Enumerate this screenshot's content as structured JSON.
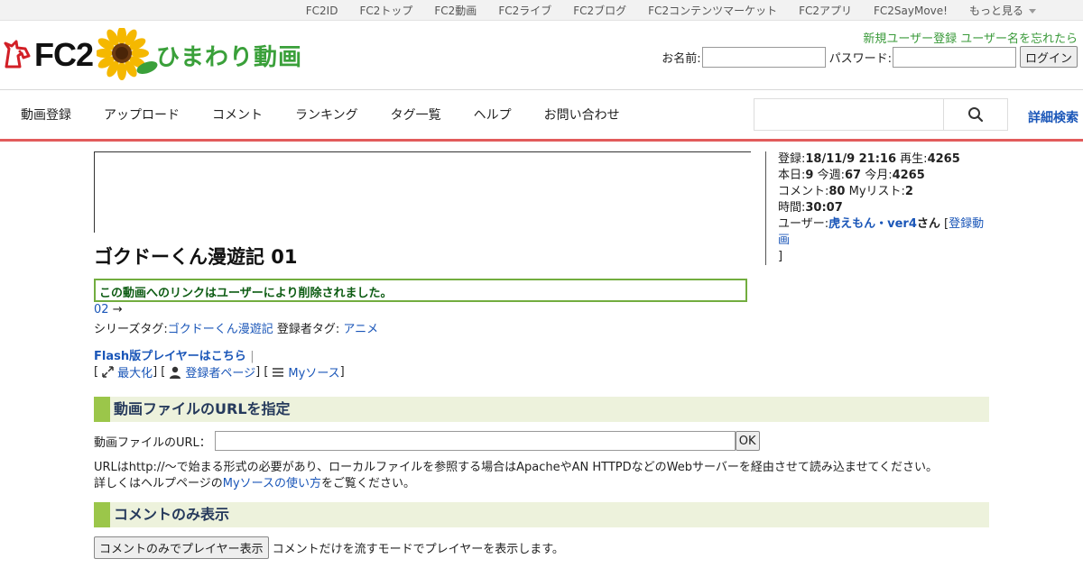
{
  "topnav": {
    "items": [
      "FC2ID",
      "FC2トップ",
      "FC2動画",
      "FC2ライブ",
      "FC2ブログ",
      "FC2コンテンツマーケット",
      "FC2アプリ",
      "FC2SayMove!",
      "もっと見る"
    ]
  },
  "header": {
    "logo_fc2": "FC2",
    "logo_text": "ひまわり動画",
    "register_link": "新規ユーザー登録",
    "forgot_link": "ユーザー名を忘れたら",
    "name_label": "お名前:",
    "password_label": "パスワード:",
    "login_button": "ログイン"
  },
  "nav": {
    "items": [
      "動画登録",
      "アップロード",
      "コメント",
      "ランキング",
      "タグ一覧",
      "ヘルプ",
      "お問い合わせ"
    ],
    "advanced_search": "詳細検索"
  },
  "stats": {
    "registered_label": "登録:",
    "registered_value": "18/11/9 21:16",
    "plays_label": "再生:",
    "plays_value": "4265",
    "today_label": "本日:",
    "today_value": "9",
    "week_label": "今週:",
    "week_value": "67",
    "month_label": "今月:",
    "month_value": "4265",
    "comments_label": "コメント:",
    "comments_value": "80",
    "mylist_label": "Myリスト:",
    "mylist_value": "2",
    "duration_label": "時間:",
    "duration_value": "30:07",
    "user_label": "ユーザー:",
    "user_name": "虎えもん・ver4",
    "user_suffix": "さん",
    "user_videos_link": "登録動画"
  },
  "video": {
    "title": "ゴクドーくん漫遊記 01",
    "notice": "この動画へのリンクはユーザーにより削除されました。",
    "next_link": "02",
    "next_arrow": "→",
    "series_label": "シリーズタグ:",
    "series_tag": "ゴクドーくん漫遊記",
    "uploader_tag_label": "登録者タグ:",
    "uploader_tag": "アニメ",
    "flash_link": "Flash版プレイヤーはこちら",
    "maximize_link": "最大化",
    "uploader_page_link": "登録者ページ",
    "mysource_link": "Myソース"
  },
  "url_section": {
    "heading": "動画ファイルのURLを指定",
    "label": "動画ファイルのURL：",
    "ok_button": "OK",
    "help_line1": "URLはhttp://～で始まる形式の必要があり、ローカルファイルを参照する場合はApacheやAN HTTPDなどのWebサーバーを経由させて読み込ませてください。",
    "help_prefix": "詳しくはヘルプページの",
    "help_link": "Myソースの使い方",
    "help_suffix": "をご覧ください。"
  },
  "comment_section": {
    "heading": "コメントのみ表示",
    "button": "コメントのみでプレイヤー表示",
    "description": "コメントだけを流すモードでプレイヤーを表示します。"
  }
}
